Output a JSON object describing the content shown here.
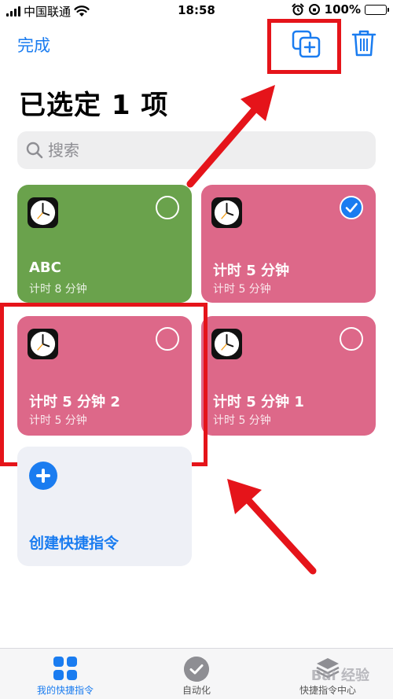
{
  "status_bar": {
    "carrier": "中国联通",
    "time": "18:58",
    "battery": "100%"
  },
  "header": {
    "done_label": "完成",
    "title": "已选定 1 项"
  },
  "search": {
    "placeholder": "搜索"
  },
  "shortcuts": [
    {
      "title": "ABC",
      "subtitle": "计时 8 分钟",
      "color": "#6aa24c",
      "selected": false
    },
    {
      "title": "计时 5 分钟",
      "subtitle": "计时 5 分钟",
      "color": "#dd6889",
      "selected": true
    },
    {
      "title": "计时 5 分钟 2",
      "subtitle": "计时 5 分钟",
      "color": "#dd6889",
      "selected": false
    },
    {
      "title": "计时 5 分钟 1",
      "subtitle": "计时 5 分钟",
      "color": "#dd6889",
      "selected": false
    }
  ],
  "create_card": {
    "label": "创建快捷指令"
  },
  "tabs": [
    {
      "label": "我的快捷指令",
      "active": true
    },
    {
      "label": "自动化",
      "active": false
    },
    {
      "label": "快捷指令中心",
      "active": false
    }
  ],
  "accent_color": "#1a7cf0",
  "annotation_color": "#e5141a"
}
